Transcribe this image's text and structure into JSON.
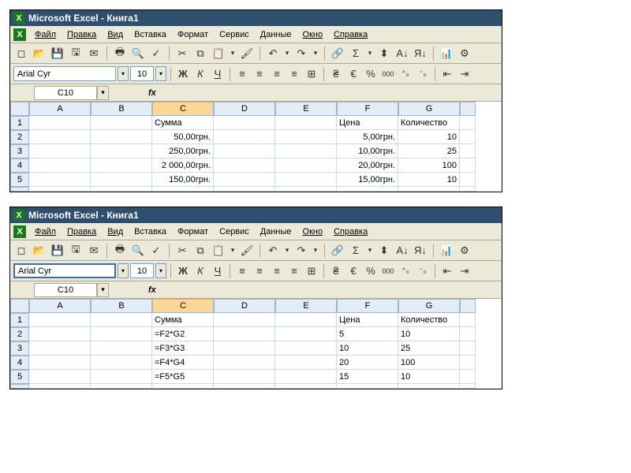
{
  "app_title": "Microsoft Excel - Книга1",
  "menus": {
    "file": "Файл",
    "edit": "Правка",
    "view": "Вид",
    "insert": "Вставка",
    "format": "Формат",
    "tools": "Сервис",
    "data": "Данные",
    "window": "Окно",
    "help": "Справка"
  },
  "font": {
    "name": "Arial Cyr",
    "size": "10"
  },
  "namebox": "C10",
  "fx": "fx",
  "columns": [
    "A",
    "B",
    "C",
    "D",
    "E",
    "F",
    "G"
  ],
  "headers": {
    "C": "Сумма",
    "F": "Цена",
    "G": "Количество"
  },
  "window1": {
    "rows": [
      {
        "n": "1",
        "C": "Сумма",
        "F": "Цена",
        "G": "Количество",
        "align": "l"
      },
      {
        "n": "2",
        "C": "50,00грн.",
        "F": "5,00грн.",
        "G": "10",
        "align": "r"
      },
      {
        "n": "3",
        "C": "250,00грн.",
        "F": "10,00грн.",
        "G": "25",
        "align": "r"
      },
      {
        "n": "4",
        "C": "2 000,00грн.",
        "F": "20,00грн.",
        "G": "100",
        "align": "r"
      },
      {
        "n": "5",
        "C": "150,00грн.",
        "F": "15,00грн.",
        "G": "10",
        "align": "r"
      }
    ]
  },
  "window2": {
    "rows": [
      {
        "n": "1",
        "C": "Сумма",
        "F": "Цена",
        "G": "Количество"
      },
      {
        "n": "2",
        "C": "=F2*G2",
        "F": "5",
        "G": "10"
      },
      {
        "n": "3",
        "C": "=F3*G3",
        "F": "10",
        "G": "25"
      },
      {
        "n": "4",
        "C": "=F4*G4",
        "F": "20",
        "G": "100"
      },
      {
        "n": "5",
        "C": "=F5*G5",
        "F": "15",
        "G": "10"
      }
    ]
  },
  "icons": {
    "new": "◻",
    "open": "📂",
    "save": "💾",
    "saveas": "🖫",
    "mail": "✉",
    "print": "🖶",
    "preview": "🔍",
    "spell": "✓",
    "cut": "✂",
    "copy": "⧉",
    "paste": "📋",
    "fmt": "🖌",
    "undo": "↶",
    "redo": "↷",
    "link": "🔗",
    "sum": "Σ",
    "sort": "⬍",
    "az": "A↓",
    "za": "Я↓",
    "chart": "📊",
    "wiz": "⚙",
    "bold": "Ж",
    "italic": "К",
    "ul": "Ч",
    "alignl": "≡",
    "alignc": "≡",
    "alignr": "≡",
    "alignj": "≡",
    "merge": "⊞",
    "curr": "₴",
    "euro": "€",
    "pct": "%",
    "comma": "000",
    "decinc": "⁺₀",
    "decdec": "⁻₀",
    "indent": "⇤",
    "outdent": "⇥"
  }
}
